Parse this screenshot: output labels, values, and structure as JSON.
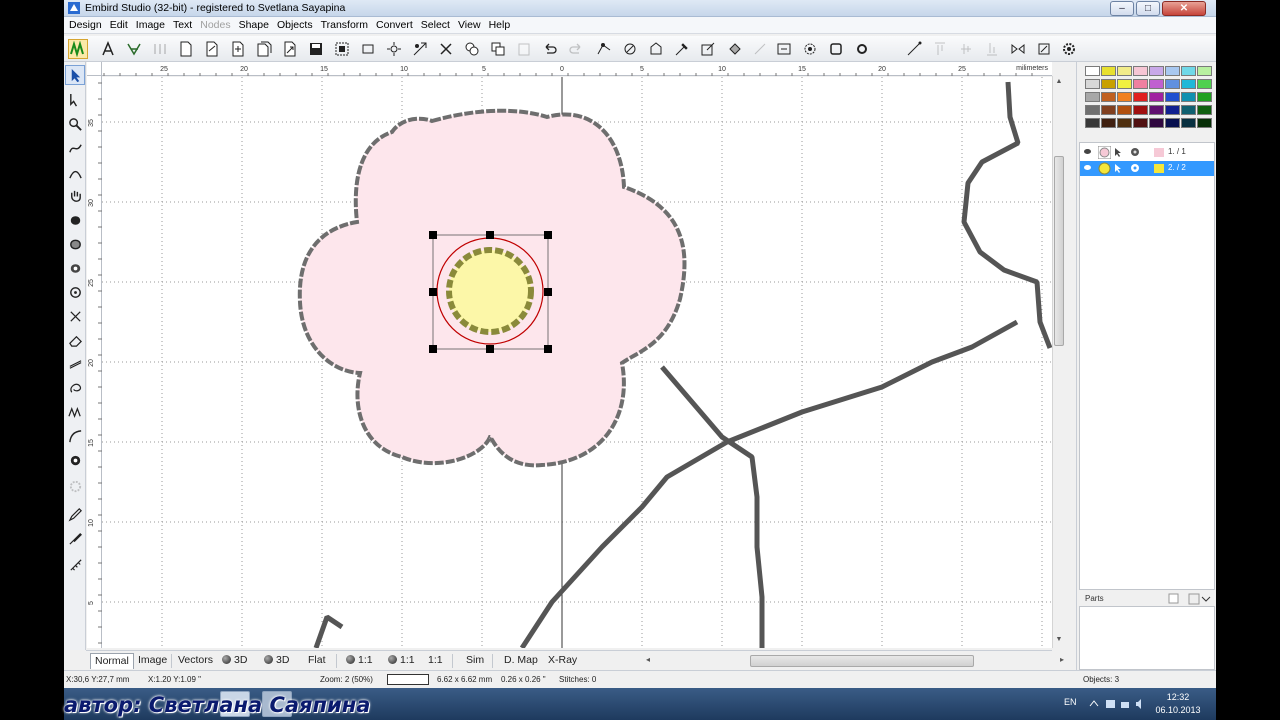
{
  "window": {
    "title": "Embird Studio (32-bit)  -  registered to Svetlana Sayapina",
    "min_glyph": "–",
    "max_glyph": "□",
    "close_glyph": "✕"
  },
  "menu": [
    {
      "label": "Design",
      "enabled": true
    },
    {
      "label": "Edit",
      "enabled": true
    },
    {
      "label": "Image",
      "enabled": true
    },
    {
      "label": "Text",
      "enabled": true
    },
    {
      "label": "Nodes",
      "enabled": false
    },
    {
      "label": "Shape",
      "enabled": true
    },
    {
      "label": "Objects",
      "enabled": true
    },
    {
      "label": "Transform",
      "enabled": true
    },
    {
      "label": "Convert",
      "enabled": true
    },
    {
      "label": "Select",
      "enabled": true
    },
    {
      "label": "View",
      "enabled": true
    },
    {
      "label": "Help",
      "enabled": true
    }
  ],
  "ruler": {
    "unit": "milimeters",
    "top_labels": [
      "25",
      "20",
      "15",
      "10",
      "5",
      "0",
      "5",
      "10",
      "15",
      "20",
      "25"
    ],
    "left_labels": [
      "35",
      "30",
      "25",
      "20",
      "15",
      "10",
      "5"
    ]
  },
  "view_tabs": [
    {
      "label": "Normal",
      "active": true,
      "ball": false
    },
    {
      "label": "Image",
      "active": false,
      "ball": false
    },
    {
      "label": "Vectors",
      "active": false,
      "ball": false
    },
    {
      "label": "3D",
      "active": false,
      "ball": true
    },
    {
      "label": "3D",
      "active": false,
      "ball": true
    },
    {
      "label": "Flat",
      "active": false,
      "ball": false
    },
    {
      "label": "1:1",
      "active": false,
      "ball": true
    },
    {
      "label": "1:1",
      "active": false,
      "ball": true
    },
    {
      "label": "1:1",
      "active": false,
      "ball": false
    },
    {
      "label": "Sim",
      "active": false,
      "ball": false
    },
    {
      "label": "D. Map",
      "active": false,
      "ball": false
    },
    {
      "label": "X-Ray",
      "active": false,
      "ball": false
    }
  ],
  "objects_panel": {
    "rows": [
      {
        "label": "1. / 1",
        "color": "#f6c9d6",
        "selected": false
      },
      {
        "label": "2. / 2",
        "color": "#f5e63a",
        "selected": true
      }
    ],
    "parts_label": "Parts"
  },
  "status": {
    "cursor": "X:30,6  Y:27,7 mm",
    "scale": "X:1.20  Y:1.09 \"",
    "zoom": "Zoom: 2 (50%)",
    "size_mm": "6.62 x 6.62 mm",
    "size_in": "0.26 x 0.26 \"",
    "stitches": "Stitches: 0",
    "objects": "Objects: 3"
  },
  "taskbar": {
    "caption": "автор: Светлана Саяпина",
    "language": "EN",
    "time": "12:32",
    "date": "06.10.2013"
  },
  "colors": {
    "petal_fill": "#fde6ec",
    "petal_edge": "#6e6e6e",
    "center_fill": "#fcf7a8",
    "center_ring": "#8a8a3a",
    "selection_outline": "#c00000",
    "stem": "#555555",
    "selected_row": "#3399ff"
  },
  "palette": [
    "#ffffff",
    "#e8e030",
    "#f2ec8a",
    "#f6c6d4",
    "#c8a8e8",
    "#a8c8f0",
    "#70d8e8",
    "#b8f0a0",
    "#d8d8d8",
    "#c8a000",
    "#f0f040",
    "#f080a0",
    "#c060d0",
    "#6090e0",
    "#20b8d8",
    "#50d050",
    "#a8a8a8",
    "#c06020",
    "#f08020",
    "#e02020",
    "#a020a0",
    "#2050d0",
    "#1090b0",
    "#20a020",
    "#707070",
    "#804020",
    "#b05010",
    "#a01010",
    "#601070",
    "#102090",
    "#106070",
    "#106010",
    "#383838",
    "#402010",
    "#503010",
    "#501010",
    "#300840",
    "#081050",
    "#083040",
    "#083008"
  ]
}
